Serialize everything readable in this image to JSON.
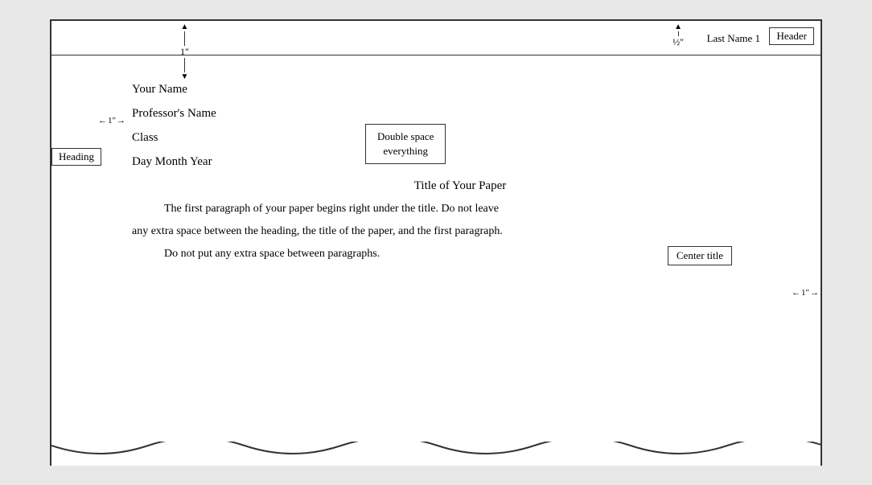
{
  "header": {
    "last_name": "Last Name 1",
    "label": "Header",
    "half_inch": "½\""
  },
  "top_margin": {
    "measurement": "1\""
  },
  "left_margin": {
    "measurement": "←1\"→"
  },
  "right_margin": {
    "measurement": "←1\"→"
  },
  "heading_box": {
    "label": "Heading"
  },
  "double_space_box": {
    "line1": "Double space",
    "line2": "everything"
  },
  "center_title_box": {
    "label": "Center title"
  },
  "content": {
    "your_name": "Your Name",
    "prof_name": "Professor's Name",
    "class_name": "Class",
    "date": "Day Month Year",
    "title": "Title of Your Paper",
    "para1": "The first paragraph of your paper begins right under the title.  Do not leave",
    "para2": "any extra space between the heading, the title of the paper, and the first paragraph.",
    "para3": "Do not put any extra space between paragraphs."
  }
}
